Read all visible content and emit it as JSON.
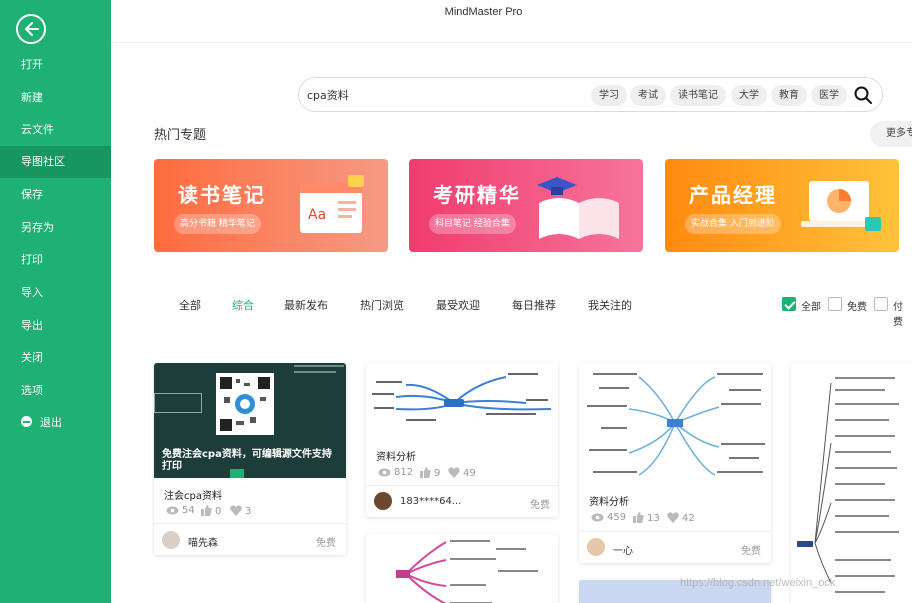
{
  "app": {
    "title": "MindMaster Pro"
  },
  "sidebar": {
    "items": [
      {
        "label": "打开"
      },
      {
        "label": "新建"
      },
      {
        "label": "云文件"
      },
      {
        "label": "导图社区"
      },
      {
        "label": "保存"
      },
      {
        "label": "另存为"
      },
      {
        "label": "打印"
      },
      {
        "label": "导入"
      },
      {
        "label": "导出"
      },
      {
        "label": "关闭"
      },
      {
        "label": "选项"
      },
      {
        "label": "退出"
      }
    ],
    "active_index": 3,
    "colors": {
      "background": "#1fb074",
      "active": "#18965f"
    }
  },
  "search": {
    "value": "cpa资料",
    "tags": [
      "学习",
      "考试",
      "读书笔记",
      "大学",
      "教育",
      "医学"
    ]
  },
  "hot_topics": {
    "title": "热门专题",
    "more_label": "更多专",
    "banners": [
      {
        "title": "读书笔记",
        "subtitle": "高分书籍 精华笔记",
        "colors": [
          "#ff6b3d",
          "#f59a85"
        ]
      },
      {
        "title": "考研精华",
        "subtitle": "科目笔记 经验合集",
        "colors": [
          "#f03c6e",
          "#f7749b"
        ]
      },
      {
        "title": "产品经理",
        "subtitle": "实战合集 入门到进阶",
        "colors": [
          "#ff8a10",
          "#ffc23b"
        ]
      }
    ]
  },
  "filters": {
    "tabs": [
      "全部",
      "综合",
      "最新发布",
      "热门浏览",
      "最受欢迎",
      "每日推荐",
      "我关注的"
    ],
    "active_tab": "综合",
    "checks": [
      {
        "label": "全部",
        "checked": true
      },
      {
        "label": "免费",
        "checked": false
      },
      {
        "label": "付费",
        "checked": false
      }
    ]
  },
  "cards": [
    {
      "title": "注会cpa资料",
      "overlay_text": "免费注会cpa资料，可编辑源文件支持打印",
      "views": "54",
      "likes": "0",
      "favorites": "3",
      "author": "喵先森",
      "price": "免费"
    },
    {
      "title": "资料分析",
      "views": "812",
      "likes": "9",
      "favorites": "49",
      "author": "183****64...",
      "price": "免费"
    },
    {
      "title": "资料分析",
      "views": "459",
      "likes": "13",
      "favorites": "42",
      "author": "一心",
      "price": "免费"
    }
  ],
  "watermark": "https://blog.csdn.net/weixin_ock"
}
